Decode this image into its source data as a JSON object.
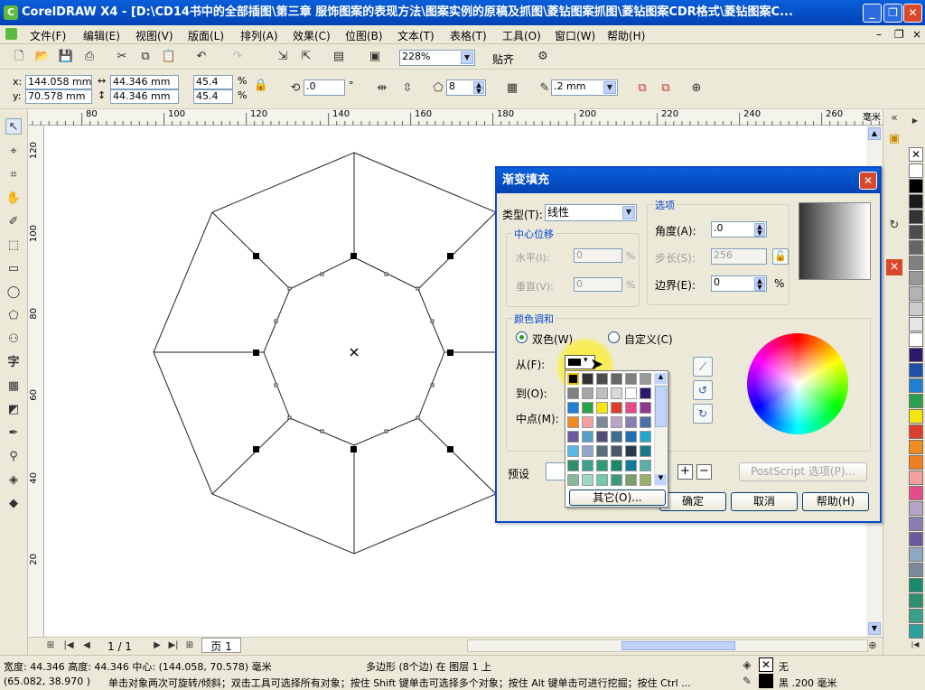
{
  "window": {
    "title": "CorelDRAW X4 - [D:\\CD14书中的全部插图\\第三章   服饰图案的表现方法\\图案实例的原稿及抓图\\菱钻图案抓图\\菱钻图案CDR格式\\菱钻图案C..."
  },
  "menu": [
    "文件(F)",
    "编辑(E)",
    "视图(V)",
    "版面(L)",
    "排列(A)",
    "效果(C)",
    "位图(B)",
    "文本(T)",
    "表格(T)",
    "工具(O)",
    "窗口(W)",
    "帮助(H)"
  ],
  "toolbar": {
    "zoom": "228%",
    "snap_label": "贴齐"
  },
  "propbar": {
    "x_label": "x:",
    "y_label": "y:",
    "x_value": "144.058 mm",
    "y_value": "70.578 mm",
    "width_value": "44.346 mm",
    "height_value": "44.346 mm",
    "scale_x": "45.4",
    "scale_y": "45.4",
    "percent": "%",
    "rotation": ".0",
    "degree": "°",
    "sides": "8",
    "outline": ".2 mm"
  },
  "ruler": {
    "h_ticks": [
      "80",
      "100",
      "120",
      "140",
      "160",
      "180",
      "200",
      "220",
      "240",
      "260"
    ],
    "h_unit": "毫米",
    "v_ticks": [
      "120",
      "100",
      "80",
      "60",
      "40",
      "20"
    ]
  },
  "pagebar": {
    "page_count": "1 / 1",
    "page_tab": "页 1"
  },
  "dialog": {
    "title": "渐变填充",
    "type_label": "类型(T):",
    "type_value": "线性",
    "center_offset_title": "中心位移",
    "horizontal_label": "水平(I):",
    "horizontal_value": "0",
    "vertical_label": "垂直(V):",
    "vertical_value": "0",
    "options_title": "选项",
    "angle_label": "角度(A):",
    "angle_value": ".0",
    "steps_label": "步长(S):",
    "steps_value": "256",
    "edge_label": "边界(E):",
    "edge_value": "0",
    "pct": "%",
    "blend_title": "颜色调和",
    "two_color_label": "双色(W)",
    "custom_label": "自定义(C)",
    "from_label": "从(F):",
    "to_label": "到(O):",
    "midpoint_label": "中点(M):",
    "preset_label": "预设",
    "postscript_label": "PostScript 选项(P)...",
    "ok_label": "确定",
    "cancel_label": "取消",
    "help_label": "帮助(H)",
    "other_label": "其它(O)..."
  },
  "color_grid": [
    [
      "#000000",
      "#333333",
      "#4d4d4d",
      "#666666",
      "#808080",
      "#999999"
    ],
    [
      "#808080",
      "#a6a6a6",
      "#bfbfbf",
      "#d9d9d9",
      "#ffffff",
      "#2b1a6b"
    ],
    [
      "#1f7fd1",
      "#2aa04a",
      "#f5e60e",
      "#e03c2c",
      "#e94a8a",
      "#8b3a8f"
    ],
    [
      "#f08c1e",
      "#f4a0a0",
      "#7a8a9a",
      "#b9a3c8",
      "#8a7fb5",
      "#4a6fa8"
    ],
    [
      "#6a5aa0",
      "#56a0c8",
      "#4f4f7a",
      "#3a6f8f",
      "#1f6fb0",
      "#23a6c9"
    ],
    [
      "#58b8e8",
      "#8fa8c8",
      "#5a6e7a",
      "#4a5a6a",
      "#2a3a4a",
      "#1a7a8a"
    ],
    [
      "#2e8f6f",
      "#3aa08a",
      "#2f9a7a",
      "#1a8a6a",
      "#0f7a9a",
      "#5ab0a8"
    ],
    [
      "#8ab89a",
      "#a0d8c8",
      "#70c8b0",
      "#3a9a7a",
      "#7aa06a",
      "#9ab06a"
    ]
  ],
  "palette": [
    "#ffffff",
    "#000000",
    "#1a1a1a",
    "#333333",
    "#4d4d4d",
    "#666666",
    "#808080",
    "#999999",
    "#b3b3b3",
    "#cccccc",
    "#e6e6e6",
    "#ffffff",
    "#2b1a6b",
    "#1f4fa8",
    "#1f7fd1",
    "#2aa04a",
    "#f5e60e",
    "#e03c2c",
    "#f08c1e",
    "#ee7f1c",
    "#f4a0a0",
    "#e94a8a",
    "#b9a3c8",
    "#8a7fb5",
    "#6a5aa0",
    "#8fa8c8",
    "#7a8a9a",
    "#1a8a6a",
    "#2e8f6f",
    "#3aa08a",
    "#2aa0a0"
  ],
  "status": {
    "size_info": "宽度: 44.346  高度: 44.346  中心: (144.058, 70.578)  毫米",
    "object_info": "多边形 (8个边) 在 图层 1 上",
    "coords": "(65.082, 38.970 )",
    "hint": "单击对象两次可旋转/倾斜；双击工具可选择所有对象；按住 Shift 键单击可选择多个对象；按住 Alt 键单击可进行挖掘；按住 Ctrl ...",
    "fill_label": "无",
    "outline_label": "黑  .200 毫米"
  }
}
